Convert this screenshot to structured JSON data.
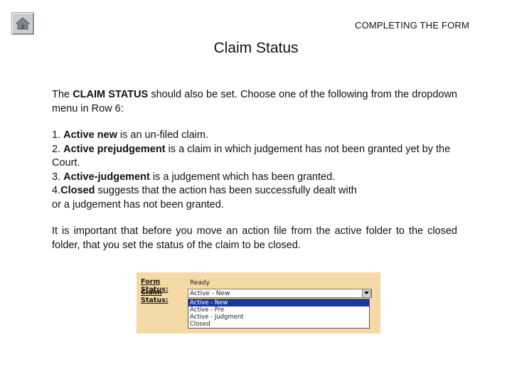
{
  "header": {
    "section_title": "COMPLETING THE FORM"
  },
  "title": "Claim Status",
  "intro": {
    "pre": "The ",
    "bold": "CLAIM STATUS",
    "post": " should also be set. Choose one of the following from the dropdown menu in Row 6:"
  },
  "list": [
    {
      "num": "1. ",
      "bold": "Active new",
      "text": " is an un-filed claim."
    },
    {
      "num": "2. ",
      "bold": "Active prejudgement",
      "text": " is a claim in which judgement has not been granted yet by the Court."
    },
    {
      "num": "3. ",
      "bold": "Active-judgement",
      "text": " is a judgement which has been granted."
    },
    {
      "num": "4.",
      "bold": "Closed",
      "text": " suggests that the action has been successfully dealt with",
      "text2": "or a judgement has not been granted."
    }
  ],
  "closing": "It is important that before you move an action file from the active folder to the closed folder, that you set the status of the claim to be closed.",
  "form_image": {
    "form_status_label": "Form Status:",
    "form_status_value": "Ready",
    "claim_status_label": "Claim Status:",
    "claim_status_value": "Active - New",
    "options": [
      "Active - New",
      "Active - Pre",
      "Active - Judgment",
      "Closed"
    ],
    "selected_index": 0,
    "colors": {
      "background": "#f5d9a6",
      "selection": "#1c36a5"
    }
  },
  "icons": {
    "home": "home-icon",
    "dropdown": "chevron-down-icon"
  }
}
